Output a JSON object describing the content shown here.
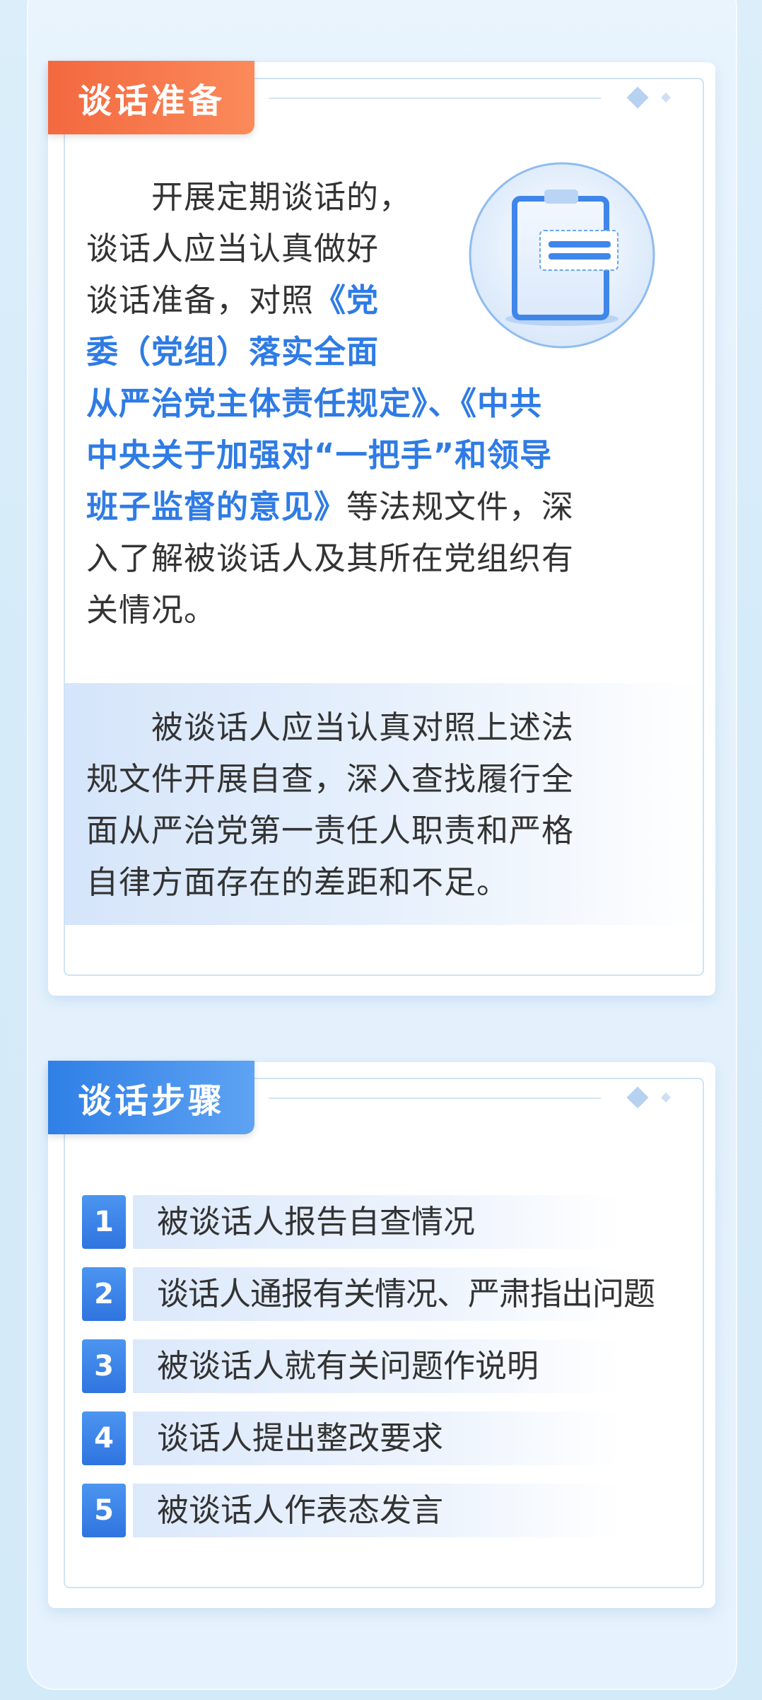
{
  "section1": {
    "title": "谈话准备",
    "para1_lines": [
      {
        "segments": [
          {
            "text": "　　开展定期谈话的，",
            "hl": false
          }
        ]
      },
      {
        "segments": [
          {
            "text": "谈话人应当认真做好",
            "hl": false
          }
        ]
      },
      {
        "segments": [
          {
            "text": "谈话准备，对照",
            "hl": false
          },
          {
            "text": "《党",
            "hl": true
          }
        ]
      },
      {
        "segments": [
          {
            "text": "委（党组）落实全面",
            "hl": true
          }
        ]
      },
      {
        "segments": [
          {
            "text": "从严治党主体责任规定》、《中共",
            "hl": true
          }
        ]
      },
      {
        "segments": [
          {
            "text": "中央关于加强对“一把手”和领导",
            "hl": true
          }
        ]
      },
      {
        "segments": [
          {
            "text": "班子监督的意见》",
            "hl": true
          },
          {
            "text": "等法规文件，深",
            "hl": false
          }
        ]
      },
      {
        "segments": [
          {
            "text": "入了解被谈话人及其所在党组织有",
            "hl": false
          }
        ]
      },
      {
        "segments": [
          {
            "text": "关情况。",
            "hl": false
          }
        ]
      }
    ],
    "para2_lines": [
      "　　被谈话人应当认真对照上述法",
      "规文件开展自查，深入查找履行全",
      "面从严治党第一责任人职责和严格",
      "自律方面存在的差距和不足。"
    ],
    "icon": "clipboard-icon"
  },
  "section2": {
    "title": "谈话步骤",
    "steps": [
      {
        "num": "1",
        "text": "被谈话人报告自查情况"
      },
      {
        "num": "2",
        "text": "谈话人通报有关情况、严肃指出问题"
      },
      {
        "num": "3",
        "text": "被谈话人就有关问题作说明"
      },
      {
        "num": "4",
        "text": "谈话人提出整改要求"
      },
      {
        "num": "5",
        "text": "被谈话人作表态发言"
      }
    ]
  },
  "colors": {
    "accent_orange": "#f3683f",
    "accent_blue": "#2f7fe6",
    "highlight_text": "#2e7be5",
    "body_text": "#333333"
  }
}
